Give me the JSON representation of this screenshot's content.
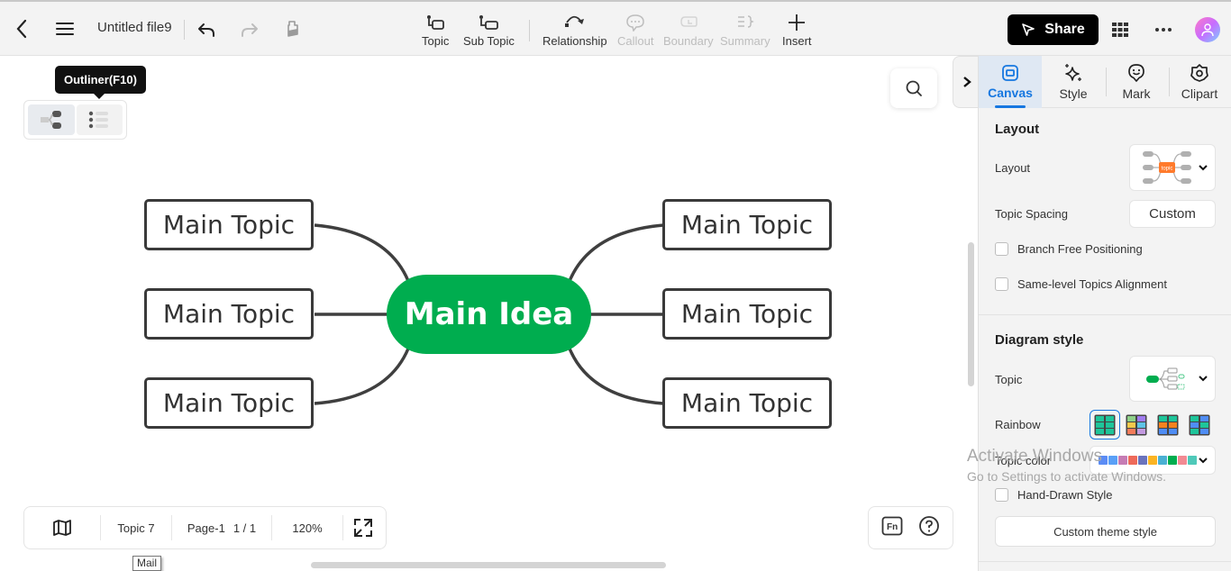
{
  "topbar": {
    "file_title": "Untitled file9",
    "tools": [
      {
        "label": "Topic",
        "icon": "topic-icon",
        "enabled": true
      },
      {
        "label": "Sub Topic",
        "icon": "subtopic-icon",
        "enabled": true
      },
      {
        "label": "Relationship",
        "icon": "relationship-icon",
        "enabled": true
      },
      {
        "label": "Callout",
        "icon": "callout-icon",
        "enabled": false
      },
      {
        "label": "Boundary",
        "icon": "boundary-icon",
        "enabled": false
      },
      {
        "label": "Summary",
        "icon": "summary-icon",
        "enabled": false
      },
      {
        "label": "Insert",
        "icon": "plus-icon",
        "enabled": true
      }
    ],
    "share_label": "Share"
  },
  "canvas": {
    "tooltip": "Outliner(F10)",
    "main_idea": "Main Idea",
    "main_idea_color": "#00ad4f",
    "topics": [
      "Main Topic",
      "Main Topic",
      "Main Topic",
      "Main Topic",
      "Main Topic",
      "Main Topic"
    ],
    "status": {
      "topic_count": "Topic 7",
      "page": "Page-1",
      "page_count": "1 / 1",
      "zoom": "120%"
    },
    "mail_tooltip": "Mail",
    "watermark": {
      "line1": "Activate Windows",
      "line2": "Go to Settings to activate Windows."
    }
  },
  "panel": {
    "tabs": [
      {
        "label": "Canvas",
        "icon": "canvas-icon",
        "active": true
      },
      {
        "label": "Style",
        "icon": "sparkle-icon",
        "active": false
      },
      {
        "label": "Mark",
        "icon": "smiley-icon",
        "active": false
      },
      {
        "label": "Clipart",
        "icon": "clipart-icon",
        "active": false
      }
    ],
    "layout_section": {
      "title": "Layout",
      "layout_label": "Layout",
      "layout_thumb_text": "topic",
      "spacing_label": "Topic Spacing",
      "spacing_value": "Custom",
      "branch_free": {
        "label": "Branch Free Positioning",
        "checked": false
      },
      "same_level": {
        "label": "Same-level Topics Alignment",
        "checked": false
      }
    },
    "diagram_section": {
      "title": "Diagram style",
      "topic_label": "Topic",
      "rainbow_label": "Rainbow",
      "topic_color_label": "Topic color",
      "topic_colors": [
        "#5b8cf5",
        "#5aa0f7",
        "#c67cb4",
        "#ee6a5a",
        "#6a73bd",
        "#fbb423",
        "#4ab0d3",
        "#00ad4f",
        "#f28a93",
        "#4fc9b9"
      ],
      "hand_drawn": {
        "label": "Hand-Drawn Style",
        "checked": false
      },
      "custom_theme_label": "Custom theme style"
    }
  }
}
